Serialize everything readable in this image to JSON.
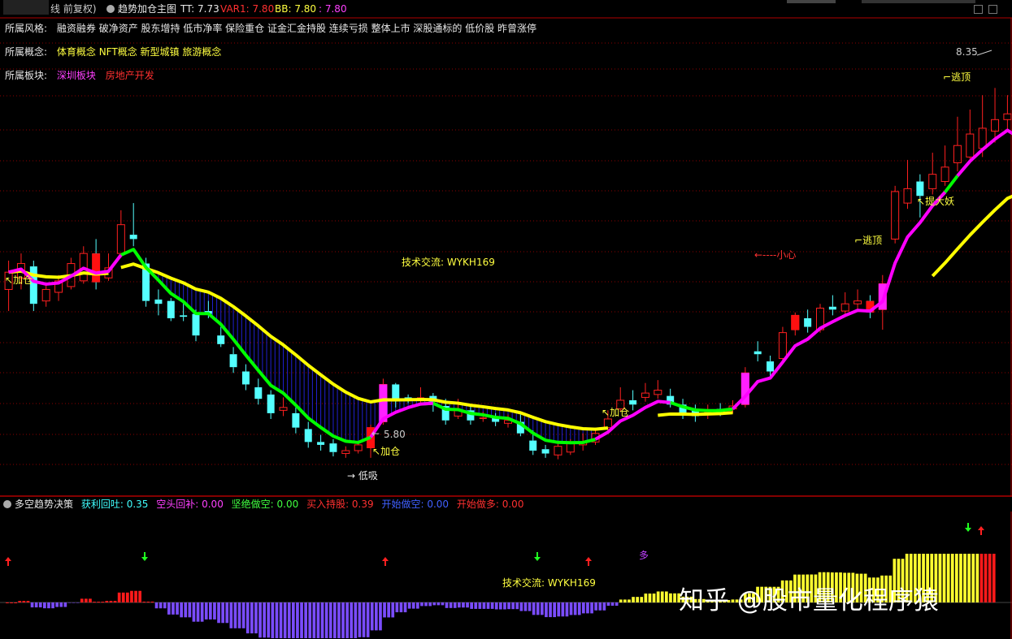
{
  "topbar": {
    "title_prefix": "线 前复权)",
    "indicator_name": "趋势加仓主图",
    "tt_label": "TT: 7.73",
    "var1_label": "VAR1: 7.80",
    "bb_label": "BB: 7.80",
    "extra_label": ": 7.80"
  },
  "info": {
    "style": {
      "key": "所属风格:",
      "value": "融资融券 破净资产 股东增持 低市净率 保险重仓 证金汇金持股 连续亏损 整体上市 深股通标的 低价股 昨曾涨停"
    },
    "concept": {
      "key": "所属概念:",
      "value": "体育概念 NFT概念 新型城镇 旅游概念"
    },
    "sector": {
      "key": "所属板块:",
      "sector1": "深圳板块",
      "sector2": "房地产开发"
    }
  },
  "annotations": {
    "high_price": "8.35",
    "low_price": "5.80",
    "jiacang": "加仓",
    "escape_top": "逃顶",
    "careful": "小心",
    "catch_demon": "提大妖",
    "low_buy": "低吸",
    "tech_exchange": "技术交流: WYKH169"
  },
  "sub_panel": {
    "name": "多空趋势决策",
    "profit": "获利回吐: 0.35",
    "short_cover": "空头回补: 0.00",
    "firm_short": "坚绝做空: 0.00",
    "buy_hold": "买入持股: 0.39",
    "start_short": "开始做空: 0.00",
    "start_long": "开始做多: 0.00",
    "duo_marker": "多",
    "tech_exchange": "技术交流: WYKH169"
  },
  "watermark": "知乎 @股市量化程序猿",
  "colors": {
    "up": "#ff2020",
    "down": "#54ffff",
    "yellow_line": "#ffff00",
    "green_line": "#00ff00",
    "magenta_line": "#ff00ff",
    "grid": "#8b0000",
    "panel_border": "#b00000"
  },
  "chart_data": {
    "type": "candlestick",
    "price_marks": {
      "high": 8.35,
      "low": 5.8
    },
    "candles": [
      {
        "o": 6.7,
        "c": 6.82,
        "h": 6.9,
        "l": 6.55
      },
      {
        "o": 6.78,
        "c": 6.88,
        "h": 6.95,
        "l": 6.7
      },
      {
        "o": 6.86,
        "c": 6.6,
        "h": 6.9,
        "l": 6.55
      },
      {
        "o": 6.62,
        "c": 6.7,
        "h": 6.74,
        "l": 6.58
      },
      {
        "o": 6.68,
        "c": 6.76,
        "h": 6.8,
        "l": 6.62
      },
      {
        "o": 6.72,
        "c": 6.88,
        "h": 6.92,
        "l": 6.7
      },
      {
        "o": 6.76,
        "c": 6.95,
        "h": 7.0,
        "l": 6.74
      },
      {
        "o": 6.95,
        "c": 6.75,
        "h": 7.05,
        "l": 6.7
      },
      {
        "o": 6.78,
        "c": 6.85,
        "h": 6.95,
        "l": 6.76
      },
      {
        "o": 6.95,
        "c": 7.15,
        "h": 7.25,
        "l": 6.92
      },
      {
        "o": 7.08,
        "c": 7.05,
        "h": 7.3,
        "l": 7.0
      },
      {
        "o": 6.88,
        "c": 6.62,
        "h": 6.92,
        "l": 6.58
      },
      {
        "o": 6.63,
        "c": 6.6,
        "h": 6.7,
        "l": 6.52
      },
      {
        "o": 6.62,
        "c": 6.5,
        "h": 6.64,
        "l": 6.48
      },
      {
        "o": 6.52,
        "c": 6.51,
        "h": 6.6,
        "l": 6.48
      },
      {
        "o": 6.53,
        "c": 6.38,
        "h": 6.56,
        "l": 6.34
      },
      {
        "o": 6.55,
        "c": 6.53,
        "h": 6.62,
        "l": 6.5
      },
      {
        "o": 6.38,
        "c": 6.32,
        "h": 6.44,
        "l": 6.3
      },
      {
        "o": 6.25,
        "c": 6.16,
        "h": 6.3,
        "l": 6.12
      },
      {
        "o": 6.13,
        "c": 6.04,
        "h": 6.18,
        "l": 6.0
      },
      {
        "o": 6.02,
        "c": 5.94,
        "h": 6.08,
        "l": 5.9
      },
      {
        "o": 5.97,
        "c": 5.84,
        "h": 6.0,
        "l": 5.8
      },
      {
        "o": 5.86,
        "c": 5.88,
        "h": 5.95,
        "l": 5.82
      },
      {
        "o": 5.84,
        "c": 5.74,
        "h": 5.88,
        "l": 5.7
      },
      {
        "o": 5.73,
        "c": 5.64,
        "h": 5.78,
        "l": 5.6
      },
      {
        "o": 5.64,
        "c": 5.62,
        "h": 5.69,
        "l": 5.58
      },
      {
        "o": 5.63,
        "c": 5.57,
        "h": 5.66,
        "l": 5.54
      },
      {
        "o": 5.56,
        "c": 5.58,
        "h": 5.61,
        "l": 5.53
      },
      {
        "o": 5.58,
        "c": 5.62,
        "h": 5.64,
        "l": 5.56
      },
      {
        "o": 5.6,
        "c": 5.74,
        "h": 5.76,
        "l": 5.53
      },
      {
        "o": 5.78,
        "c": 6.04,
        "h": 6.08,
        "l": 5.76
      },
      {
        "o": 6.04,
        "c": 5.93,
        "h": 6.05,
        "l": 5.88
      },
      {
        "o": 5.95,
        "c": 5.94,
        "h": 5.97,
        "l": 5.91
      },
      {
        "o": 5.94,
        "c": 5.95,
        "h": 6.02,
        "l": 5.9
      },
      {
        "o": 5.96,
        "c": 5.92,
        "h": 5.98,
        "l": 5.85
      },
      {
        "o": 5.89,
        "c": 5.79,
        "h": 5.94,
        "l": 5.76
      },
      {
        "o": 5.82,
        "c": 5.86,
        "h": 5.94,
        "l": 5.8
      },
      {
        "o": 5.86,
        "c": 5.79,
        "h": 5.9,
        "l": 5.76
      },
      {
        "o": 5.8,
        "c": 5.81,
        "h": 5.85,
        "l": 5.78
      },
      {
        "o": 5.81,
        "c": 5.78,
        "h": 5.84,
        "l": 5.75
      },
      {
        "o": 5.77,
        "c": 5.79,
        "h": 5.83,
        "l": 5.74
      },
      {
        "o": 5.78,
        "c": 5.7,
        "h": 5.83,
        "l": 5.68
      },
      {
        "o": 5.65,
        "c": 5.58,
        "h": 5.72,
        "l": 5.55
      },
      {
        "o": 5.59,
        "c": 5.56,
        "h": 5.62,
        "l": 5.53
      },
      {
        "o": 5.55,
        "c": 5.61,
        "h": 5.63,
        "l": 5.52
      },
      {
        "o": 5.57,
        "c": 5.63,
        "h": 5.66,
        "l": 5.55
      },
      {
        "o": 5.62,
        "c": 5.64,
        "h": 5.7,
        "l": 5.58
      },
      {
        "o": 5.64,
        "c": 5.7,
        "h": 5.74,
        "l": 5.62
      },
      {
        "o": 5.74,
        "c": 5.8,
        "h": 5.86,
        "l": 5.7
      },
      {
        "o": 5.87,
        "c": 5.93,
        "h": 6.02,
        "l": 5.85
      },
      {
        "o": 5.93,
        "c": 5.9,
        "h": 6.0,
        "l": 5.86
      },
      {
        "o": 5.95,
        "c": 5.98,
        "h": 6.05,
        "l": 5.92
      },
      {
        "o": 5.97,
        "c": 6.0,
        "h": 6.07,
        "l": 5.94
      },
      {
        "o": 5.96,
        "c": 5.9,
        "h": 6.01,
        "l": 5.88
      },
      {
        "o": 5.9,
        "c": 5.83,
        "h": 5.94,
        "l": 5.8
      },
      {
        "o": 5.86,
        "c": 5.82,
        "h": 5.9,
        "l": 5.78
      },
      {
        "o": 5.84,
        "c": 5.85,
        "h": 5.9,
        "l": 5.8
      },
      {
        "o": 5.87,
        "c": 5.86,
        "h": 5.91,
        "l": 5.82
      },
      {
        "o": 5.87,
        "c": 5.89,
        "h": 5.93,
        "l": 5.84
      },
      {
        "o": 5.9,
        "c": 6.12,
        "h": 6.16,
        "l": 5.88
      },
      {
        "o": 6.27,
        "c": 6.25,
        "h": 6.34,
        "l": 6.2
      },
      {
        "o": 6.2,
        "c": 6.13,
        "h": 6.24,
        "l": 6.1
      },
      {
        "o": 6.22,
        "c": 6.4,
        "h": 6.44,
        "l": 6.18
      },
      {
        "o": 6.42,
        "c": 6.52,
        "h": 6.54,
        "l": 6.38
      },
      {
        "o": 6.5,
        "c": 6.44,
        "h": 6.56,
        "l": 6.4
      },
      {
        "o": 6.42,
        "c": 6.57,
        "h": 6.6,
        "l": 6.4
      },
      {
        "o": 6.58,
        "c": 6.56,
        "h": 6.66,
        "l": 6.52
      },
      {
        "o": 6.55,
        "c": 6.6,
        "h": 6.68,
        "l": 6.52
      },
      {
        "o": 6.6,
        "c": 6.62,
        "h": 6.7,
        "l": 6.55
      },
      {
        "o": 6.62,
        "c": 6.54,
        "h": 6.66,
        "l": 6.5
      },
      {
        "o": 6.56,
        "c": 6.74,
        "h": 6.8,
        "l": 6.42
      },
      {
        "o": 7.05,
        "c": 7.38,
        "h": 7.42,
        "l": 7.02
      },
      {
        "o": 7.3,
        "c": 7.4,
        "h": 7.6,
        "l": 7.26
      },
      {
        "o": 7.45,
        "c": 7.35,
        "h": 7.5,
        "l": 7.2
      },
      {
        "o": 7.4,
        "c": 7.5,
        "h": 7.65,
        "l": 7.36
      },
      {
        "o": 7.45,
        "c": 7.55,
        "h": 7.7,
        "l": 7.42
      },
      {
        "o": 7.58,
        "c": 7.7,
        "h": 7.9,
        "l": 7.52
      },
      {
        "o": 7.62,
        "c": 7.78,
        "h": 7.95,
        "l": 7.58
      },
      {
        "o": 7.68,
        "c": 7.82,
        "h": 8.05,
        "l": 7.62
      },
      {
        "o": 7.8,
        "c": 7.88,
        "h": 8.1,
        "l": 7.72
      },
      {
        "o": 7.88,
        "c": 7.92,
        "h": 8.05,
        "l": 7.8
      },
      {
        "o": 7.8,
        "c": 7.65,
        "h": 7.88,
        "l": 7.55
      },
      {
        "o": 7.6,
        "c": 7.55,
        "h": 7.7,
        "l": 7.5
      },
      {
        "o": 7.5,
        "c": 7.44,
        "h": 7.62,
        "l": 7.4
      },
      {
        "o": 7.5,
        "c": 7.86,
        "h": 7.92,
        "l": 7.46
      },
      {
        "o": 7.88,
        "c": 7.98,
        "h": 8.08,
        "l": 7.84
      }
    ]
  }
}
